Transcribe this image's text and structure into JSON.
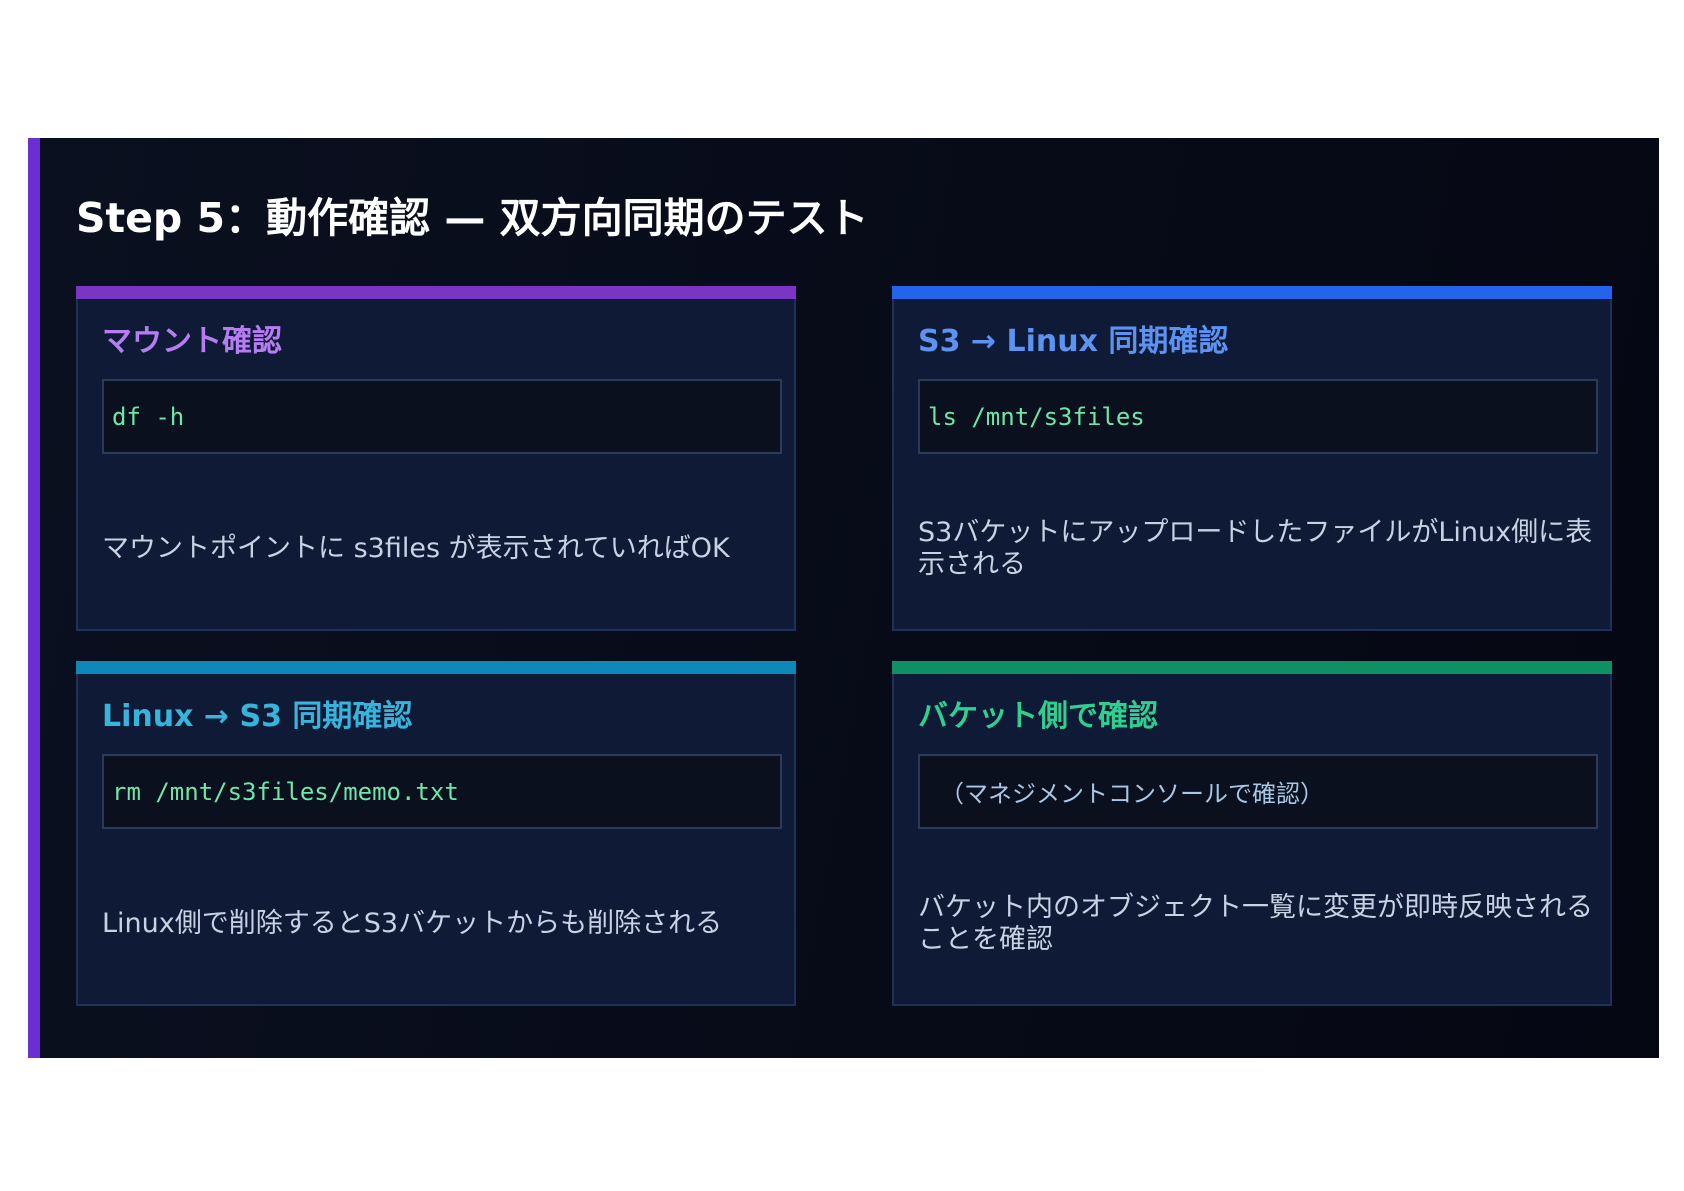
{
  "slide": {
    "title": "Step 5：動作確認 — 双方向同期のテスト",
    "accent_color": "#6a2fd0"
  },
  "cards": [
    {
      "heading": "マウント確認",
      "command": "df -h",
      "description": "マウントポイントに s3files が表示されていればOK",
      "accent_color": "#7b35c4",
      "heading_color": "#b67cf2"
    },
    {
      "heading": "S3 → Linux 同期確認",
      "command": "ls /mnt/s3files",
      "description": "S3バケットにアップロードしたファイルがLinux側に表示される",
      "accent_color": "#2563eb",
      "heading_color": "#5c93f2"
    },
    {
      "heading": "Linux → S3 同期確認",
      "command": "rm /mnt/s3files/memo.txt",
      "description": "Linux側で削除するとS3バケットからも削除される",
      "accent_color": "#0e88b8",
      "heading_color": "#37b3dc"
    },
    {
      "heading": "バケット側で確認",
      "command": "（マネジメントコンソールで確認）",
      "description": "バケット内のオブジェクト一覧に変更が即時反映されることを確認",
      "accent_color": "#0f8f64",
      "heading_color": "#2fcf8f"
    }
  ]
}
